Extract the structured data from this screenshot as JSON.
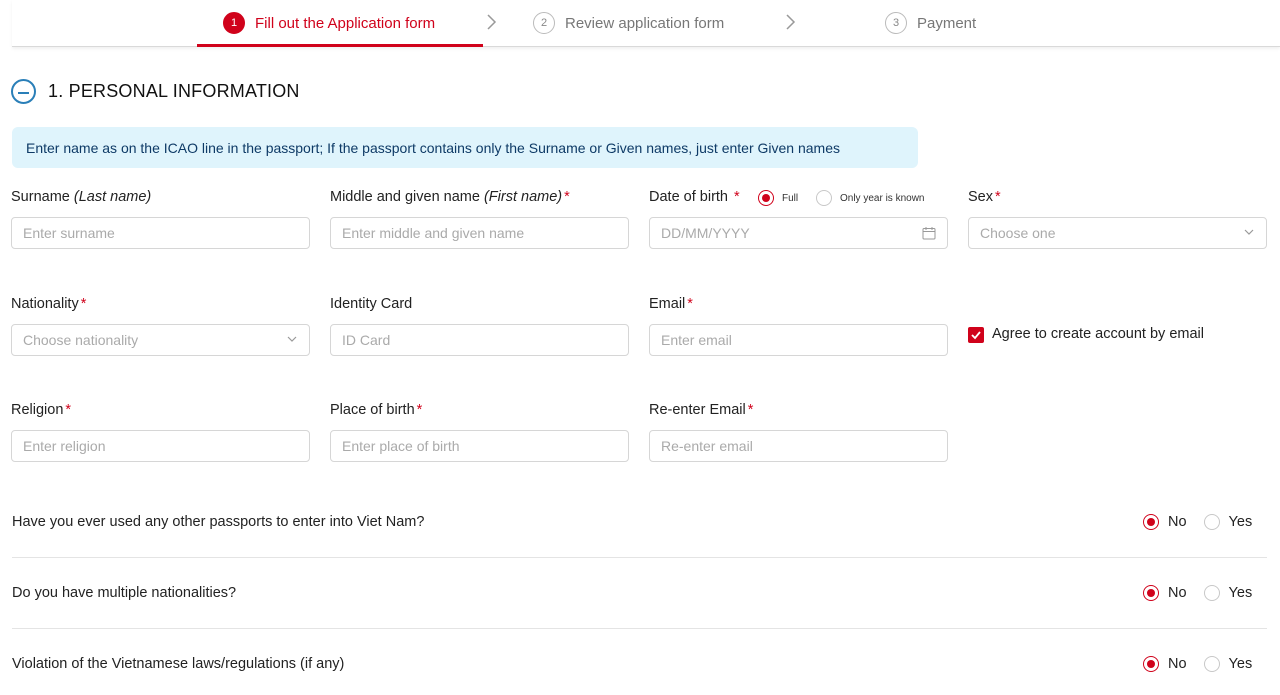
{
  "stepper": {
    "steps": [
      {
        "num": "1",
        "label": "Fill out the Application form",
        "active": true
      },
      {
        "num": "2",
        "label": "Review application form",
        "active": false
      },
      {
        "num": "3",
        "label": "Payment",
        "active": false
      }
    ]
  },
  "section": {
    "title": "1. PERSONAL INFORMATION",
    "info": "Enter name as on the ICAO line in the passport; If the passport contains only the Surname or Given names, just enter Given names"
  },
  "fields": {
    "surname": {
      "label": "Surname",
      "hint": "(Last name)",
      "placeholder": "Enter surname"
    },
    "given": {
      "label": "Middle and given name",
      "hint": "(First name)",
      "required": "*",
      "placeholder": "Enter middle and given name"
    },
    "dob": {
      "label": "Date of birth",
      "required": "*",
      "placeholder": "DD/MM/YYYY",
      "opt_full": "Full",
      "opt_year": "Only year is known",
      "selected": "Full"
    },
    "sex": {
      "label": "Sex",
      "required": "*",
      "placeholder": "Choose one"
    },
    "nationality": {
      "label": "Nationality",
      "required": "*",
      "placeholder": "Choose nationality"
    },
    "identity": {
      "label": "Identity Card",
      "placeholder": "ID Card"
    },
    "email": {
      "label": "Email",
      "required": "*",
      "placeholder": "Enter email"
    },
    "agree": {
      "label": "Agree to create account by email",
      "checked": true
    },
    "religion": {
      "label": "Religion",
      "required": "*",
      "placeholder": "Enter religion"
    },
    "pob": {
      "label": "Place of birth",
      "required": "*",
      "placeholder": "Enter place of birth"
    },
    "reemail": {
      "label": "Re-enter Email",
      "required": "*",
      "placeholder": "Re-enter email"
    }
  },
  "questions": [
    {
      "text": "Have you ever used any other passports to enter into Viet Nam?",
      "no": "No",
      "yes": "Yes",
      "selected": "No"
    },
    {
      "text": "Do you have multiple nationalities?",
      "no": "No",
      "yes": "Yes",
      "selected": "No"
    },
    {
      "text": "Violation of the Vietnamese laws/regulations (if any)",
      "no": "No",
      "yes": "Yes",
      "selected": "No"
    }
  ],
  "colors": {
    "accent": "#d0021b",
    "info_bg": "#dff4fc",
    "info_text": "#0e3a66",
    "section_icon": "#2a7fb8"
  }
}
